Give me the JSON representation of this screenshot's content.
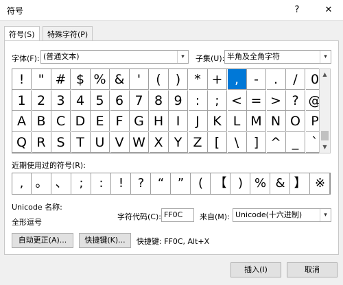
{
  "window": {
    "title": "符号",
    "help_glyph": "?",
    "close_glyph": "✕"
  },
  "tabs": [
    {
      "label": "符号(S)"
    },
    {
      "label": "特殊字符(P)"
    }
  ],
  "font": {
    "label": "字体(F):",
    "value": "(普通文本)"
  },
  "subset": {
    "label": "子集(U):",
    "value": "半角及全角字符"
  },
  "symbol_grid": {
    "rows": [
      [
        "!",
        "\"",
        "#",
        "$",
        "%",
        "&",
        "'",
        "(",
        ")",
        "*",
        "+",
        ",",
        "-",
        ".",
        "/",
        "0"
      ],
      [
        "1",
        "2",
        "3",
        "4",
        "5",
        "6",
        "7",
        "8",
        "9",
        ":",
        ";",
        "<",
        "=",
        ">",
        "?",
        "@"
      ],
      [
        "A",
        "B",
        "C",
        "D",
        "E",
        "F",
        "G",
        "H",
        "I",
        "J",
        "K",
        "L",
        "M",
        "N",
        "O",
        "P"
      ],
      [
        "Q",
        "R",
        "S",
        "T",
        "U",
        "V",
        "W",
        "X",
        "Y",
        "Z",
        "[",
        "\\",
        "]",
        "^",
        "_",
        "`"
      ]
    ],
    "selected": ","
  },
  "recent": {
    "label": "近期使用过的符号(R):",
    "symbols": [
      ",",
      "。",
      "、",
      ";",
      ":",
      "!",
      "?",
      "“",
      "”",
      "(",
      "【",
      ")",
      "%",
      "&",
      "】",
      "※"
    ]
  },
  "unicode_name_label": "Unicode 名称:",
  "char_name": "全形逗号",
  "char_code": {
    "label": "字符代码(C):",
    "value": "FF0C"
  },
  "from": {
    "label": "来自(M):",
    "value": "Unicode(十六进制)"
  },
  "buttons": {
    "autocorrect": "自动更正(A)...",
    "shortcut_key": "快捷键(K)...",
    "insert": "插入(I)",
    "cancel": "取消"
  },
  "shortcut_info": "快捷键: FF0C, Alt+X",
  "icons": {
    "dropdown": "▾",
    "scroll_up": "▲",
    "scroll_down": "▼"
  }
}
